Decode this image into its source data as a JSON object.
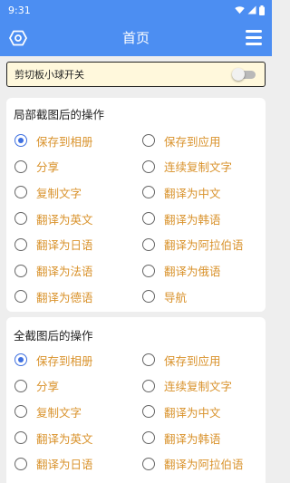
{
  "status_bar": {
    "time": "9:31"
  },
  "app_bar": {
    "title": "首页"
  },
  "clipboard_toggle": {
    "label": "剪切板小球开关",
    "on": false
  },
  "partial_section": {
    "title": "局部截图后的操作",
    "options": [
      {
        "label": "保存到相册",
        "checked": true
      },
      {
        "label": "保存到应用",
        "checked": false
      },
      {
        "label": "分享",
        "checked": false
      },
      {
        "label": "连续复制文字",
        "checked": false
      },
      {
        "label": "复制文字",
        "checked": false
      },
      {
        "label": "翻译为中文",
        "checked": false
      },
      {
        "label": "翻译为英文",
        "checked": false
      },
      {
        "label": "翻译为韩语",
        "checked": false
      },
      {
        "label": "翻译为日语",
        "checked": false
      },
      {
        "label": "翻译为阿拉伯语",
        "checked": false
      },
      {
        "label": "翻译为法语",
        "checked": false
      },
      {
        "label": "翻译为俄语",
        "checked": false
      },
      {
        "label": "翻译为德语",
        "checked": false
      },
      {
        "label": "导航",
        "checked": false
      }
    ]
  },
  "full_section": {
    "title": "全截图后的操作",
    "options": [
      {
        "label": "保存到相册",
        "checked": true
      },
      {
        "label": "保存到应用",
        "checked": false
      },
      {
        "label": "分享",
        "checked": false
      },
      {
        "label": "连续复制文字",
        "checked": false
      },
      {
        "label": "复制文字",
        "checked": false
      },
      {
        "label": "翻译为中文",
        "checked": false
      },
      {
        "label": "翻译为英文",
        "checked": false
      },
      {
        "label": "翻译为韩语",
        "checked": false
      },
      {
        "label": "翻译为日语",
        "checked": false
      },
      {
        "label": "翻译为阿拉伯语",
        "checked": false
      }
    ]
  },
  "colors": {
    "primary": "#4c8ef2",
    "option_text": "#d9922b",
    "radio_checked": "#3d6fe0",
    "toggle_card_bg": "#fff8dc"
  },
  "icons": {
    "settings": "hexagon-settings-icon",
    "menu": "hamburger-menu-icon",
    "wifi": "wifi-icon",
    "signal": "signal-icon",
    "battery": "battery-icon"
  }
}
